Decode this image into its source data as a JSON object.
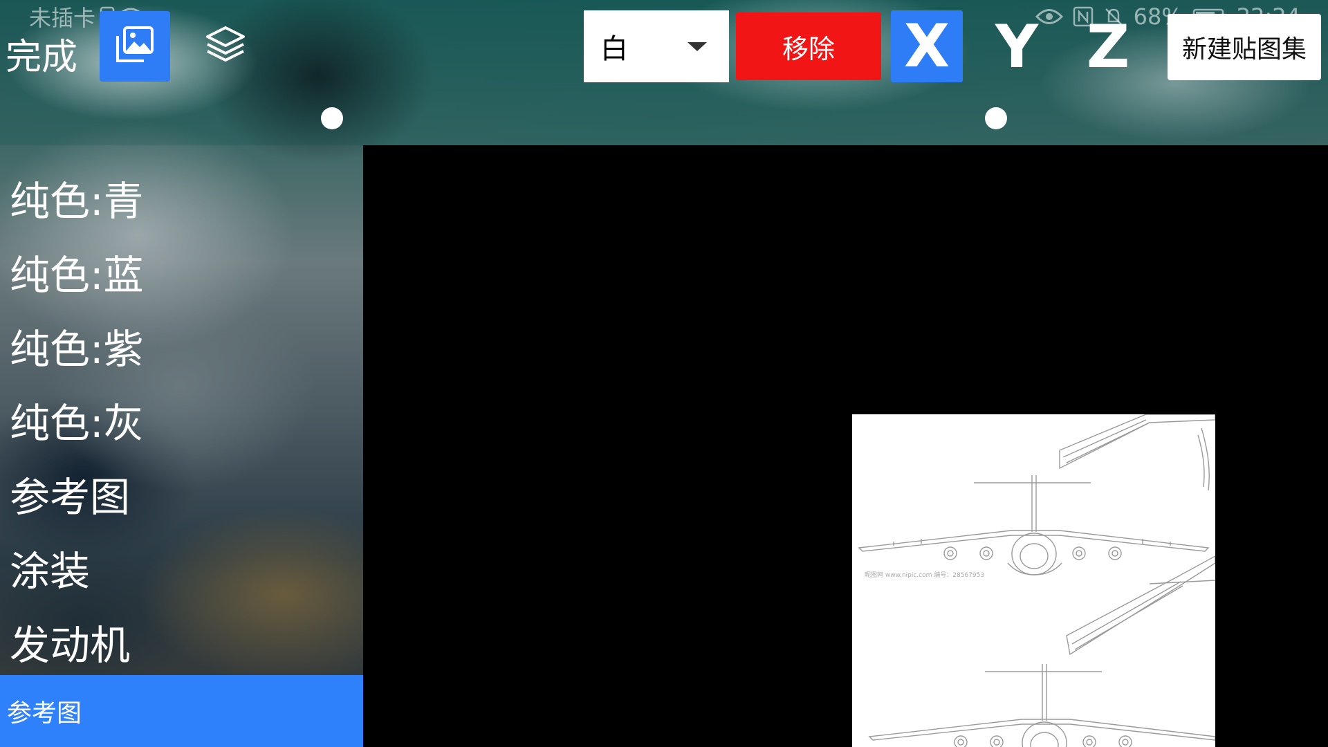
{
  "status_bar": {
    "sim_text": "未插卡",
    "battery": "68%",
    "time": "22:24"
  },
  "toolbar": {
    "done_label": "完成",
    "color_value": "白",
    "remove_label": "移除",
    "axis_x": "X",
    "axis_y": "Y",
    "axis_z": "Z",
    "new_set_label": "新建贴图集"
  },
  "sidebar": {
    "items": [
      {
        "label": "纯色:青"
      },
      {
        "label": "纯色:蓝"
      },
      {
        "label": "纯色:紫"
      },
      {
        "label": "纯色:灰"
      },
      {
        "label": "参考图"
      },
      {
        "label": "涂装"
      },
      {
        "label": "发动机"
      }
    ],
    "selected_label": "参考图"
  },
  "preview": {
    "watermark": "昵图网 www.nipic.com  编号：28567953"
  },
  "colors": {
    "accent_blue": "#2f7df6",
    "remove_red": "#f21515",
    "selected_bar": "#2f81fb"
  },
  "icons": {
    "image_button": "image-gallery-icon",
    "layers_button": "layers-icon",
    "dropdown": "caret-down-icon"
  }
}
